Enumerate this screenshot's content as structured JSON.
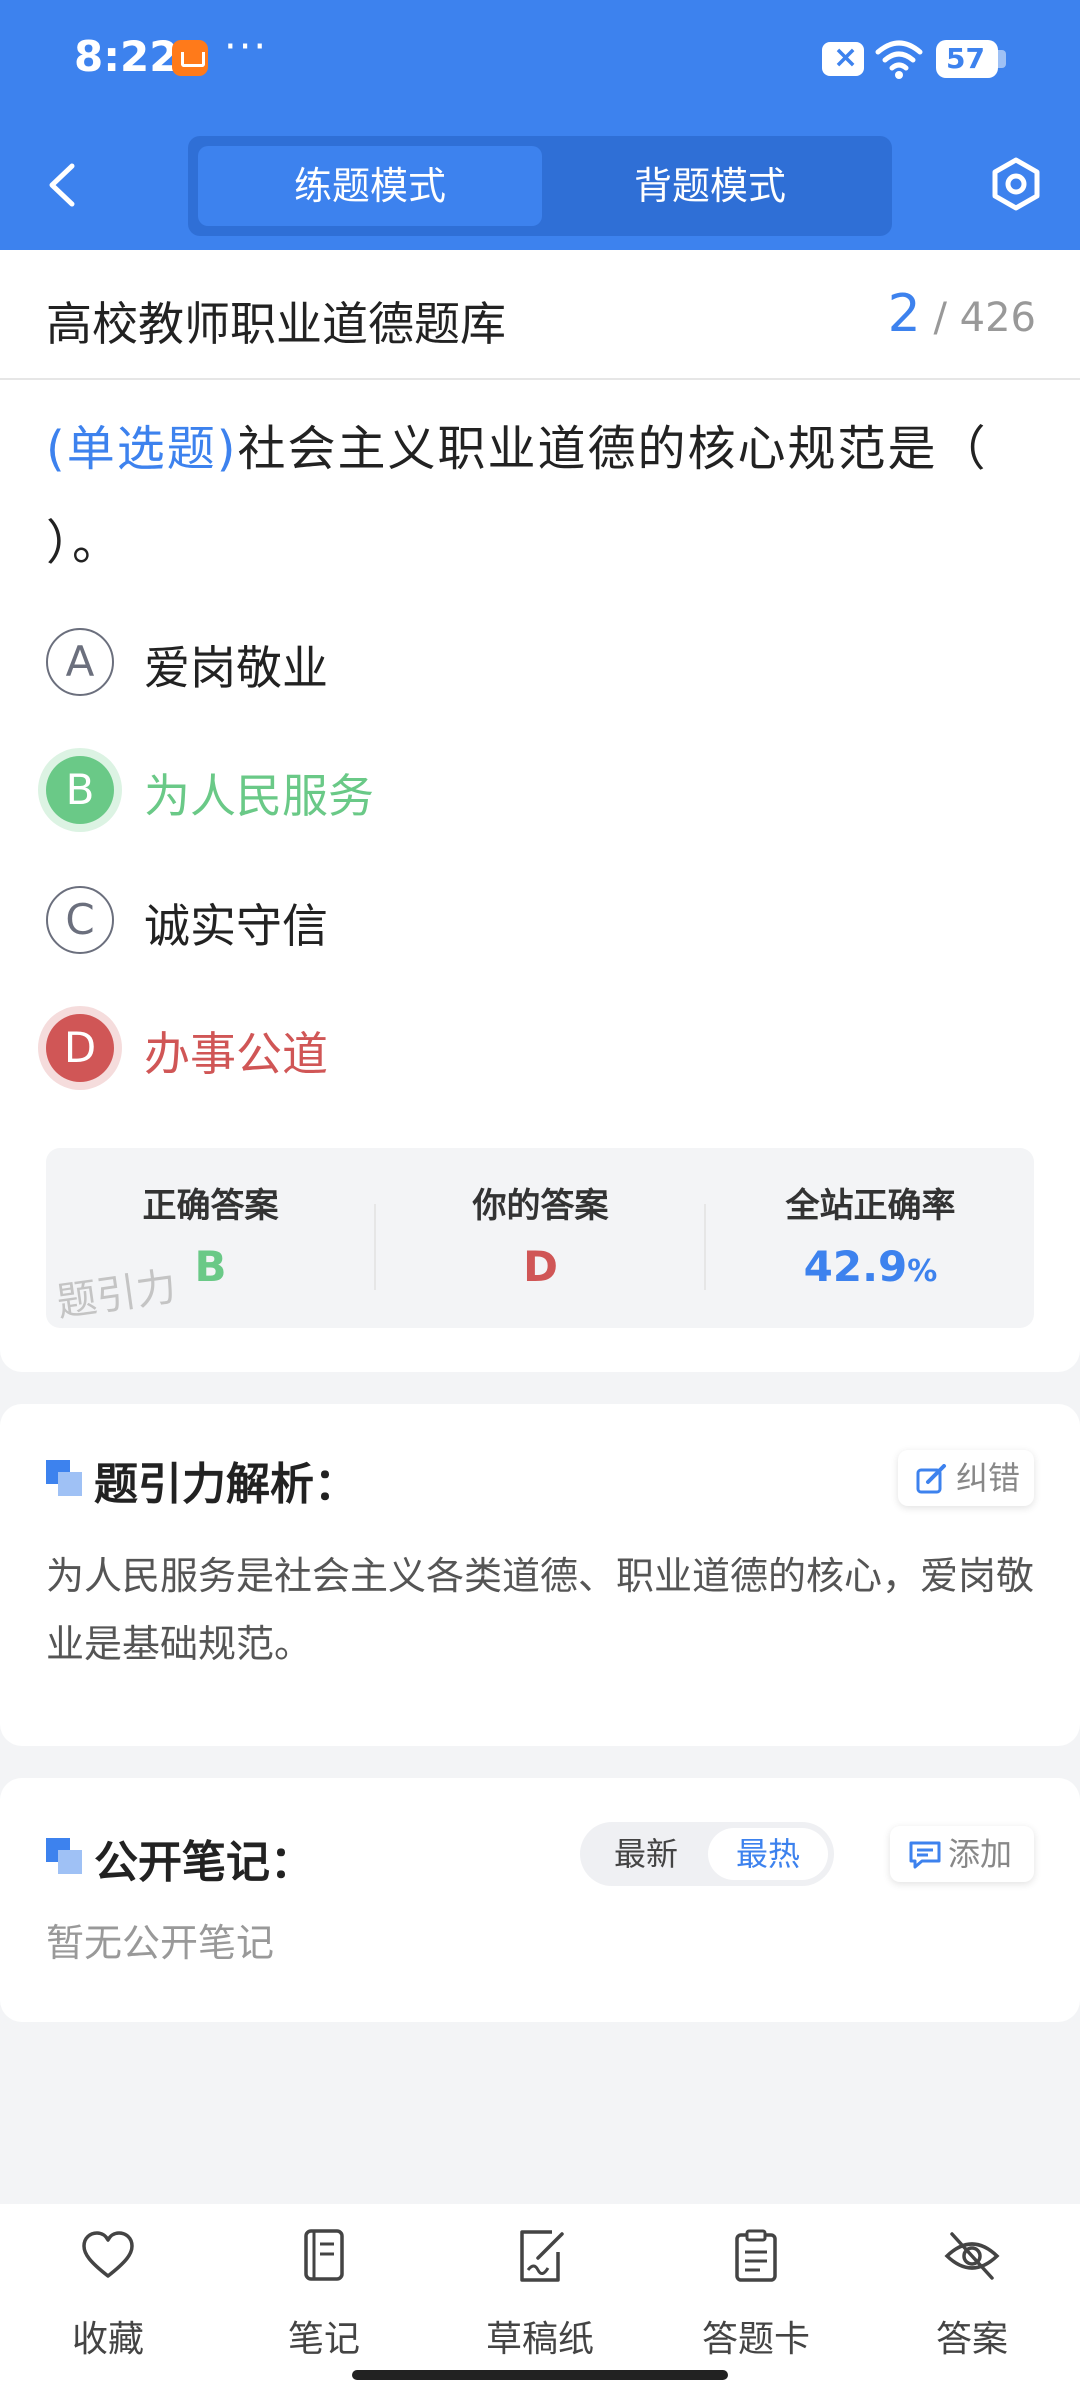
{
  "status_bar": {
    "time": "8:22",
    "dots": "···",
    "battery": "57"
  },
  "header": {
    "mode_tabs": [
      {
        "label": "练题模式",
        "active": true
      },
      {
        "label": "背题模式",
        "active": false
      }
    ],
    "back_icon": "chevron-left-icon",
    "settings_icon": "hexagon-settings-icon",
    "accent_color": "#3d82ee"
  },
  "bank": {
    "title": "高校教师职业道德题库",
    "current": "2",
    "total": "/ 426"
  },
  "question": {
    "type_label": "(单选题)",
    "text": "社会主义职业道德的核心规范是（ ）。"
  },
  "options": [
    {
      "letter": "A",
      "text": "爱岗敬业",
      "state": "normal"
    },
    {
      "letter": "B",
      "text": "为人民服务",
      "state": "correct"
    },
    {
      "letter": "C",
      "text": "诚实守信",
      "state": "normal"
    },
    {
      "letter": "D",
      "text": "办事公道",
      "state": "wrong"
    }
  ],
  "stats": {
    "correct_label": "正确答案",
    "correct_value": "B",
    "yours_label": "你的答案",
    "yours_value": "D",
    "rate_label": "全站正确率",
    "rate_value": "42.9",
    "rate_unit": "%",
    "watermark": "题引力"
  },
  "analysis": {
    "title": "题引力解析：",
    "report_label": "纠错",
    "text": "为人民服务是社会主义各类道德、职业道德的核心，爱岗敬业是基础规范。"
  },
  "notes": {
    "title": "公开笔记：",
    "sort_options": [
      "最新",
      "最热"
    ],
    "sort_selected": "最热",
    "add_label": "添加",
    "empty_text": "暂无公开笔记"
  },
  "bottom_nav": [
    {
      "label": "收藏",
      "icon": "heart-icon"
    },
    {
      "label": "笔记",
      "icon": "notebook-icon"
    },
    {
      "label": "草稿纸",
      "icon": "draft-paper-icon"
    },
    {
      "label": "答题卡",
      "icon": "answer-sheet-icon"
    },
    {
      "label": "答案",
      "icon": "eye-off-icon"
    }
  ],
  "colors": {
    "correct": "#6ac987",
    "wrong": "#d05656",
    "primary": "#3d82ee"
  }
}
